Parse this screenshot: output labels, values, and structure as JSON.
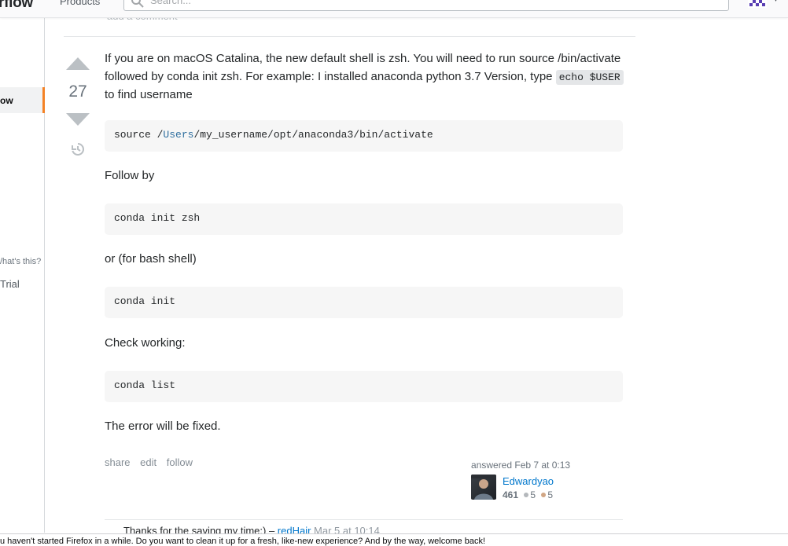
{
  "header": {
    "logo_text": "rflow",
    "products_label": "Products",
    "search_placeholder": "Search..."
  },
  "sidebar": {
    "active_label": "ow",
    "whats_this": "/hat's this?",
    "trial_label": "Trial"
  },
  "previous": {
    "add_comment": "add a comment"
  },
  "answer": {
    "vote_count": "27",
    "p1_text_a": "If you are on macOS Catalina, the new default shell is zsh. You will need to run source /bin/activate followed by conda init zsh. For example: I installed anaconda python 3.7 Version, type ",
    "p1_code": "echo $USER",
    "p1_text_b": " to find username",
    "code1_a": "source /",
    "code1_kw": "Users",
    "code1_b": "/my_username/opt/anaconda3/bin/activate",
    "text_follow": "Follow by",
    "code2": "conda init zsh",
    "text_bash": "or (for bash shell)",
    "code3": "conda init",
    "text_check": "Check working:",
    "code4": "conda list",
    "text_fixed": "The error will be fixed."
  },
  "actions": {
    "share": "share",
    "edit": "edit",
    "follow": "follow"
  },
  "user": {
    "answered": "answered Feb 7 at 0:13",
    "name": "Edwardyao",
    "reputation": "461",
    "silver": "5",
    "bronze": "5",
    "silver_color": "#b4b8bc",
    "bronze_color": "#d1a684"
  },
  "comment": {
    "text": "Thanks for the saving my time:) – ",
    "user": "redHair",
    "date": " Mar 5 at 10:14"
  },
  "notification": {
    "text": "u haven't started Firefox in a while. Do you want to clean it up for a fresh, like-new experience? And by the way, welcome back!"
  }
}
